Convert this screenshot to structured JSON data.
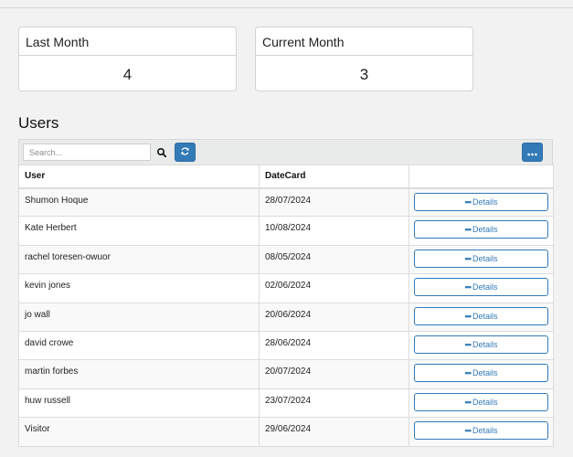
{
  "cards": [
    {
      "title": "Last Month",
      "value": "4"
    },
    {
      "title": "Current Month",
      "value": "3"
    }
  ],
  "users_section": {
    "title": "Users",
    "search_placeholder": "Search...",
    "columns": [
      "User",
      "DateCard",
      ""
    ],
    "details_label": "Details",
    "rows": [
      {
        "user": "Shumon Hoque",
        "date": "28/07/2024"
      },
      {
        "user": "Kate Herbert",
        "date": "10/08/2024"
      },
      {
        "user": "rachel toresen-owuor",
        "date": "08/05/2024"
      },
      {
        "user": "kevin jones",
        "date": "02/06/2024"
      },
      {
        "user": "jo wall",
        "date": "20/06/2024"
      },
      {
        "user": "david crowe",
        "date": "28/06/2024"
      },
      {
        "user": "martin forbes",
        "date": "20/07/2024"
      },
      {
        "user": "huw russell",
        "date": "23/07/2024"
      },
      {
        "user": "Visitor",
        "date": "29/06/2024"
      }
    ]
  },
  "colors": {
    "accent": "#337ab7",
    "background": "#f1f2f1"
  },
  "icons": {
    "search": "search-icon",
    "refresh": "refresh-icon",
    "more": "ellipsis-icon"
  }
}
